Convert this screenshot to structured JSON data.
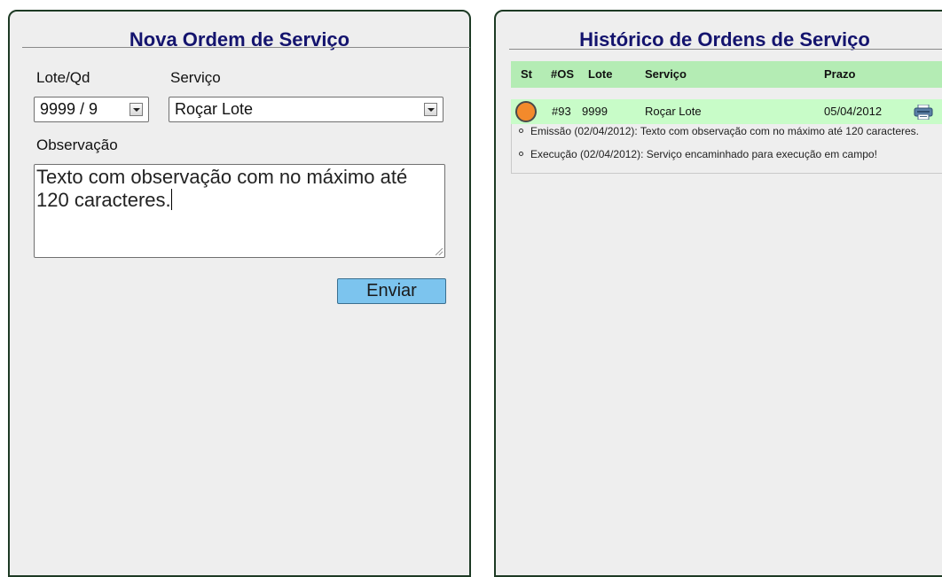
{
  "left_panel": {
    "title": "Nova Ordem de Serviço",
    "lote_label": "Lote/Qd",
    "lote_value": "9999 / 9",
    "servico_label": "Serviço",
    "servico_value": "Roçar Lote",
    "observacao_label": "Observação",
    "observacao_value": "Texto com observação com no máximo até 120 caracteres.",
    "submit_label": "Enviar"
  },
  "right_panel": {
    "title": "Histórico de Ordens de Serviço",
    "columns": [
      "St",
      "#OS",
      "Lote",
      "Serviço",
      "Prazo"
    ],
    "rows": [
      {
        "status_color": "#f38a2c",
        "os": "#93",
        "lote": "9999",
        "servico": "Roçar Lote",
        "prazo": "05/04/2012",
        "action_icon": "printer-icon",
        "notes": [
          "Emissão (02/04/2012): Texto com observação com no máximo até 120 caracteres.",
          "Execução (02/04/2012): Serviço encaminhado para execução em campo!"
        ]
      }
    ]
  },
  "colors": {
    "title_text": "#14146e",
    "panel_border": "#1d3a24",
    "header_row_bg": "#b4ecb4",
    "data_row_bg": "#c8fcc8",
    "button_bg": "#7cc4ee"
  }
}
